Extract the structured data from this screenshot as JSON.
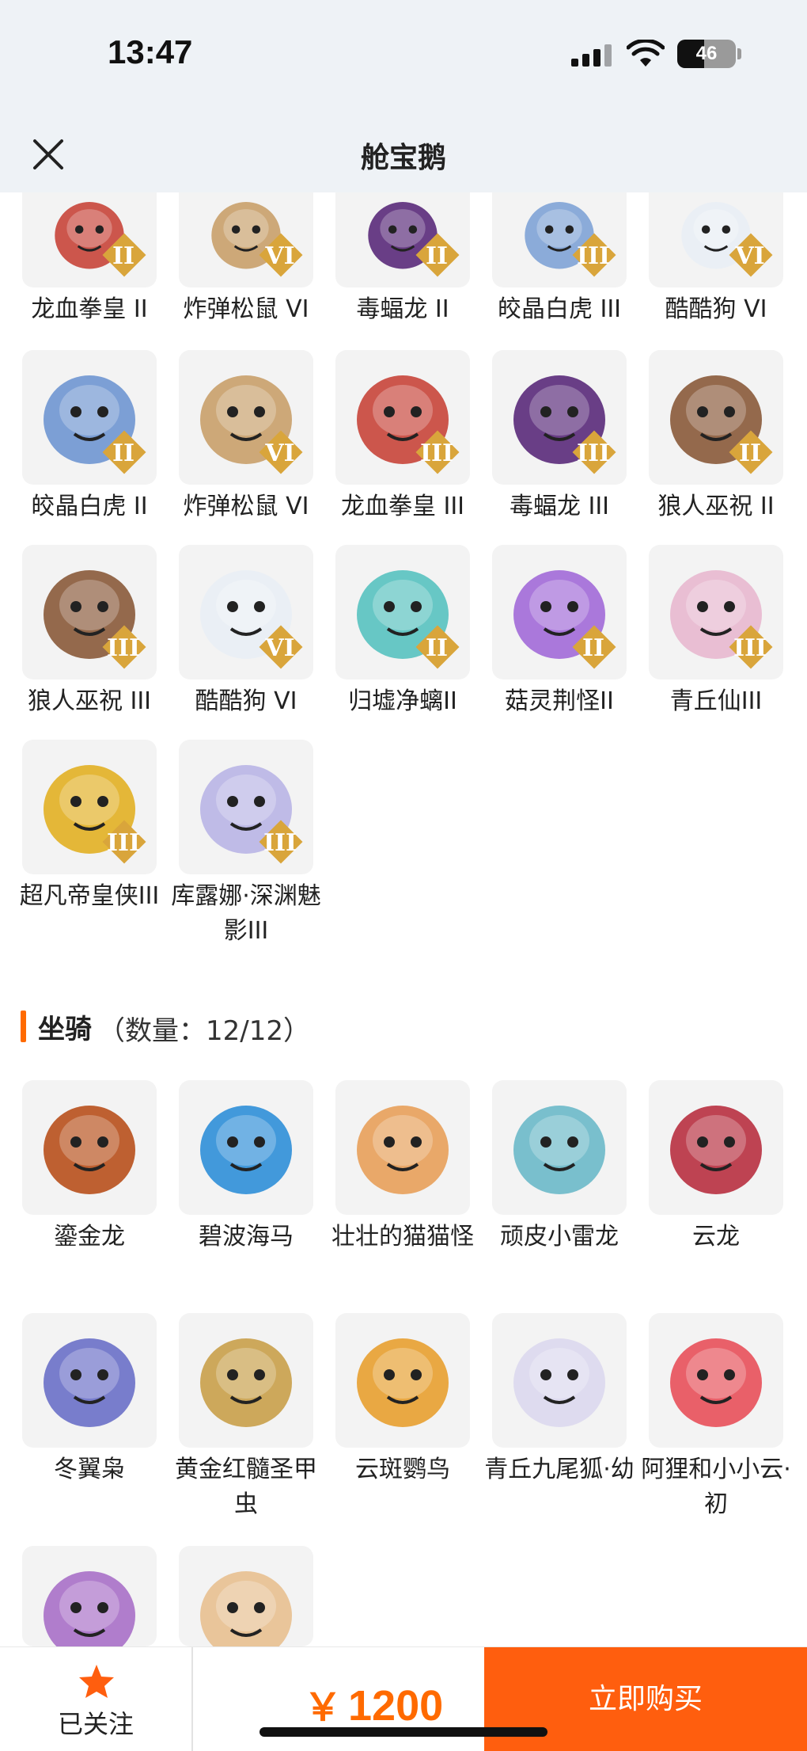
{
  "status": {
    "time": "13:47",
    "battery": "46",
    "battery_level": 0.46
  },
  "nav": {
    "title": "舱宝鹅"
  },
  "pets": [
    {
      "label": "龙血拳皇 II",
      "badge": "II",
      "color": "#c8453a"
    },
    {
      "label": "炸弹松鼠 VI",
      "badge": "VI",
      "color": "#c9a06a"
    },
    {
      "label": "毒蝠龙 II",
      "badge": "II",
      "color": "#5a2a7a"
    },
    {
      "label": "皎晶白虎 III",
      "badge": "III",
      "color": "#7fa3d6"
    },
    {
      "label": "酷酷狗 VI",
      "badge": "VI",
      "color": "#e9eef5"
    },
    {
      "label": "皎晶白虎 II",
      "badge": "II",
      "color": "#6f96d1"
    },
    {
      "label": "炸弹松鼠 VI",
      "badge": "VI",
      "color": "#c9a06a"
    },
    {
      "label": "龙血拳皇 III",
      "badge": "III",
      "color": "#c8453a"
    },
    {
      "label": "毒蝠龙 III",
      "badge": "III",
      "color": "#5a2a7a"
    },
    {
      "label": "狼人巫祝 II",
      "badge": "II",
      "color": "#8a5a3a"
    },
    {
      "label": "狼人巫祝 III",
      "badge": "III",
      "color": "#8a5a3a"
    },
    {
      "label": "酷酷狗 VI",
      "badge": "VI",
      "color": "#e9eef5"
    },
    {
      "label": "归墟净螭II",
      "badge": "II",
      "color": "#58c2c0"
    },
    {
      "label": "菇灵荆怪II",
      "badge": "II",
      "color": "#a26ad8"
    },
    {
      "label": "青丘仙III",
      "badge": "III",
      "color": "#e8b8cf"
    },
    {
      "label": "超凡帝皇侠III",
      "badge": "III",
      "color": "#e2b024"
    },
    {
      "label": "库露娜·深渊魅影III",
      "badge": "III",
      "color": "#b9b5e6"
    }
  ],
  "mounts_section": {
    "title": "坐骑",
    "count": "（数量：12/12）"
  },
  "mounts": [
    {
      "label": "鎏金龙",
      "color": "#b8501c"
    },
    {
      "label": "碧波海马",
      "color": "#2f8fd8"
    },
    {
      "label": "壮壮的猫猫怪",
      "color": "#e8a05a"
    },
    {
      "label": "顽皮小雷龙",
      "color": "#6cb9c9"
    },
    {
      "label": "云龙",
      "color": "#b83040"
    },
    {
      "label": "冬翼枭",
      "color": "#6a70c8"
    },
    {
      "label": "黄金红髓圣甲虫",
      "color": "#c9a04a"
    },
    {
      "label": "云斑鹦鸟",
      "color": "#e8a030"
    },
    {
      "label": "青丘九尾狐·幼",
      "color": "#dcd8ee"
    },
    {
      "label": "阿狸和小小云·初",
      "color": "#e8505a"
    },
    {
      "label": "",
      "color": "#a870c8"
    },
    {
      "label": "",
      "color": "#e8c090"
    }
  ],
  "bottom": {
    "follow_label": "已关注",
    "price_symbol": "￥",
    "price": "1200",
    "buy_label": "立即购买"
  },
  "colors": {
    "accent": "#ff5e0e",
    "section_bar": "#ff6a00",
    "badge": "#d9a53b"
  }
}
